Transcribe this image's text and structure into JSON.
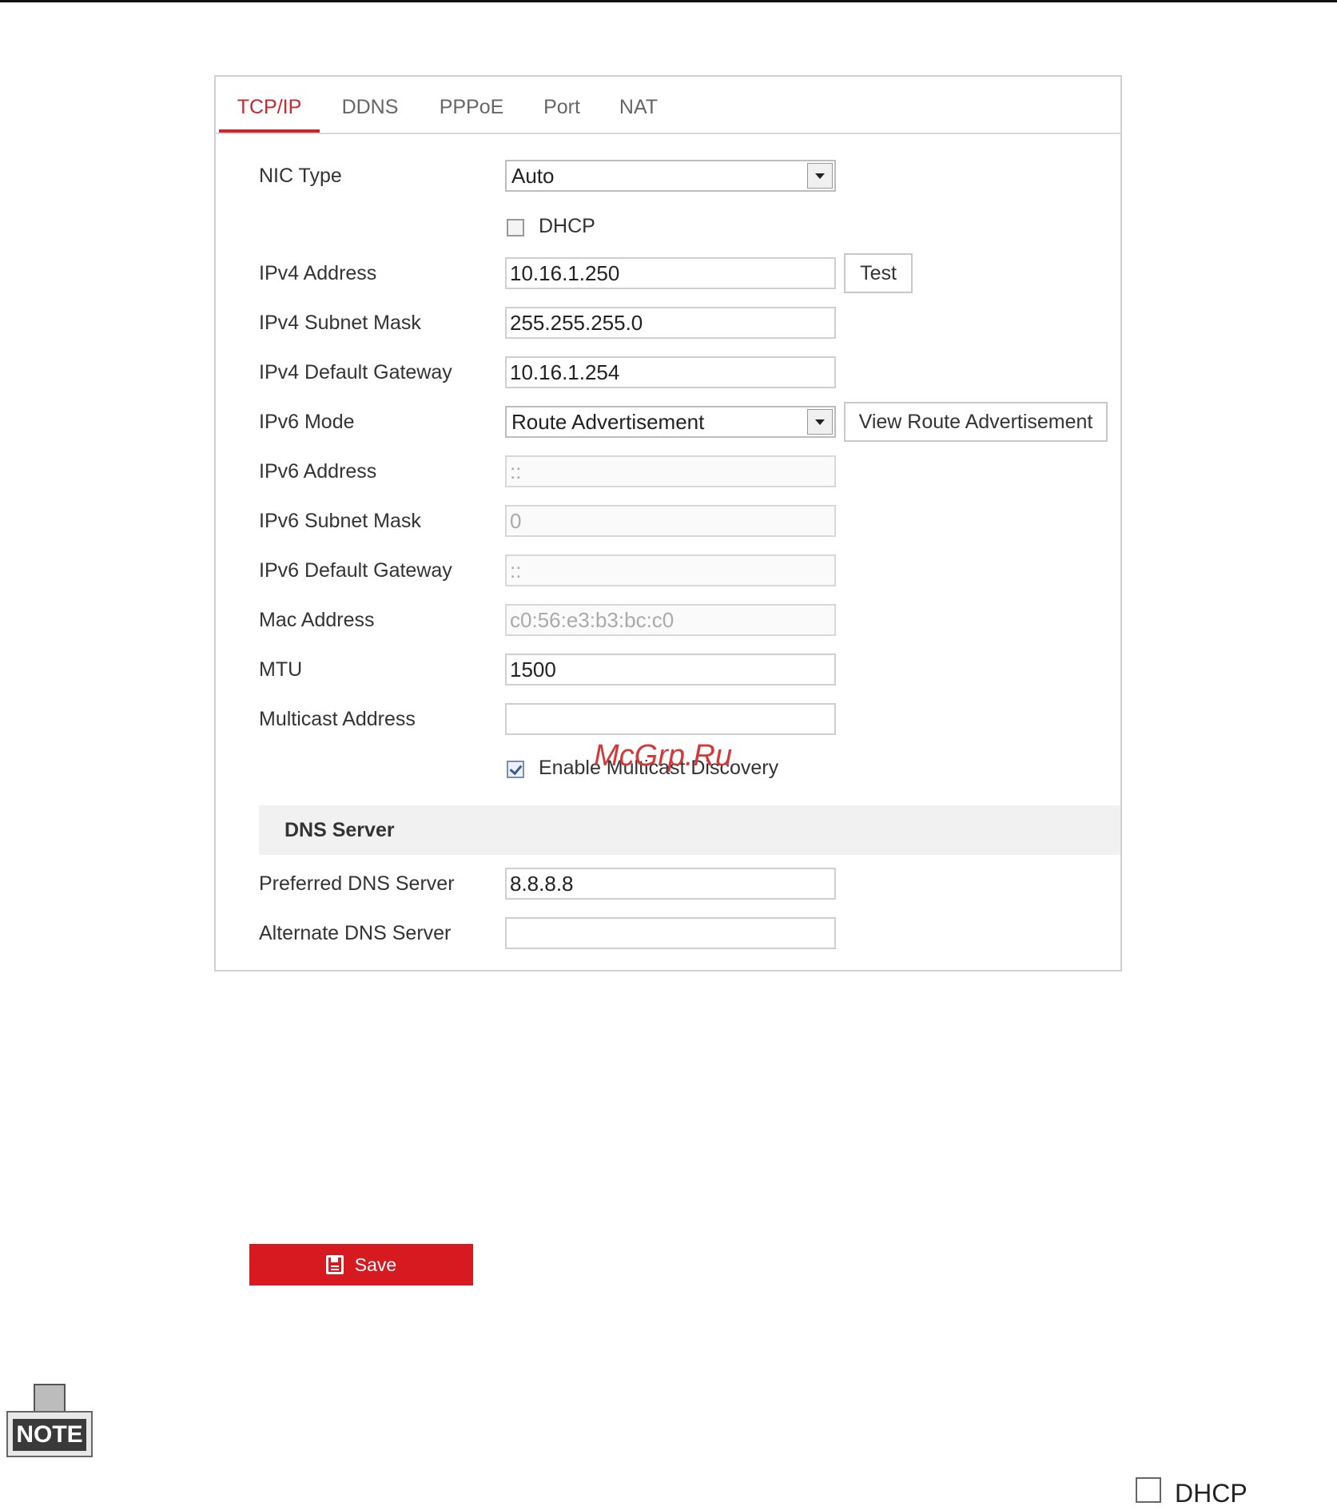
{
  "tabs": [
    "TCP/IP",
    "DDNS",
    "PPPoE",
    "Port",
    "NAT"
  ],
  "active_tab": "TCP/IP",
  "form": {
    "nic_type": {
      "label": "NIC Type",
      "value": "Auto"
    },
    "dhcp": {
      "label": "DHCP",
      "checked": false
    },
    "ipv4_address": {
      "label": "IPv4 Address",
      "value": "10.16.1.250"
    },
    "test_button": "Test",
    "ipv4_subnet": {
      "label": "IPv4 Subnet Mask",
      "value": "255.255.255.0"
    },
    "ipv4_gateway": {
      "label": "IPv4 Default Gateway",
      "value": "10.16.1.254"
    },
    "ipv6_mode": {
      "label": "IPv6 Mode",
      "value": "Route Advertisement"
    },
    "view_route_button": "View Route Advertisement",
    "ipv6_address": {
      "label": "IPv6 Address",
      "value": "::"
    },
    "ipv6_subnet": {
      "label": "IPv6 Subnet Mask",
      "value": "0"
    },
    "ipv6_gateway": {
      "label": "IPv6 Default Gateway",
      "value": "::"
    },
    "mac_address": {
      "label": "Mac Address",
      "value": "c0:56:e3:b3:bc:c0"
    },
    "mtu": {
      "label": "MTU",
      "value": "1500"
    },
    "multicast": {
      "label": "Multicast Address",
      "value": ""
    },
    "multicast_discovery": {
      "label": "Enable Multicast Discovery",
      "checked": true
    }
  },
  "dns": {
    "section_title": "DNS Server",
    "preferred": {
      "label": "Preferred DNS Server",
      "value": "8.8.8.8"
    },
    "alternate": {
      "label": "Alternate DNS Server",
      "value": ""
    }
  },
  "watermark": "McGrp.Ru",
  "save_button": "Save",
  "note_label": "NOTE",
  "bottom_dhcp_label": "DHCP",
  "colors": {
    "accent": "#c8272d",
    "save": "#d71920"
  }
}
